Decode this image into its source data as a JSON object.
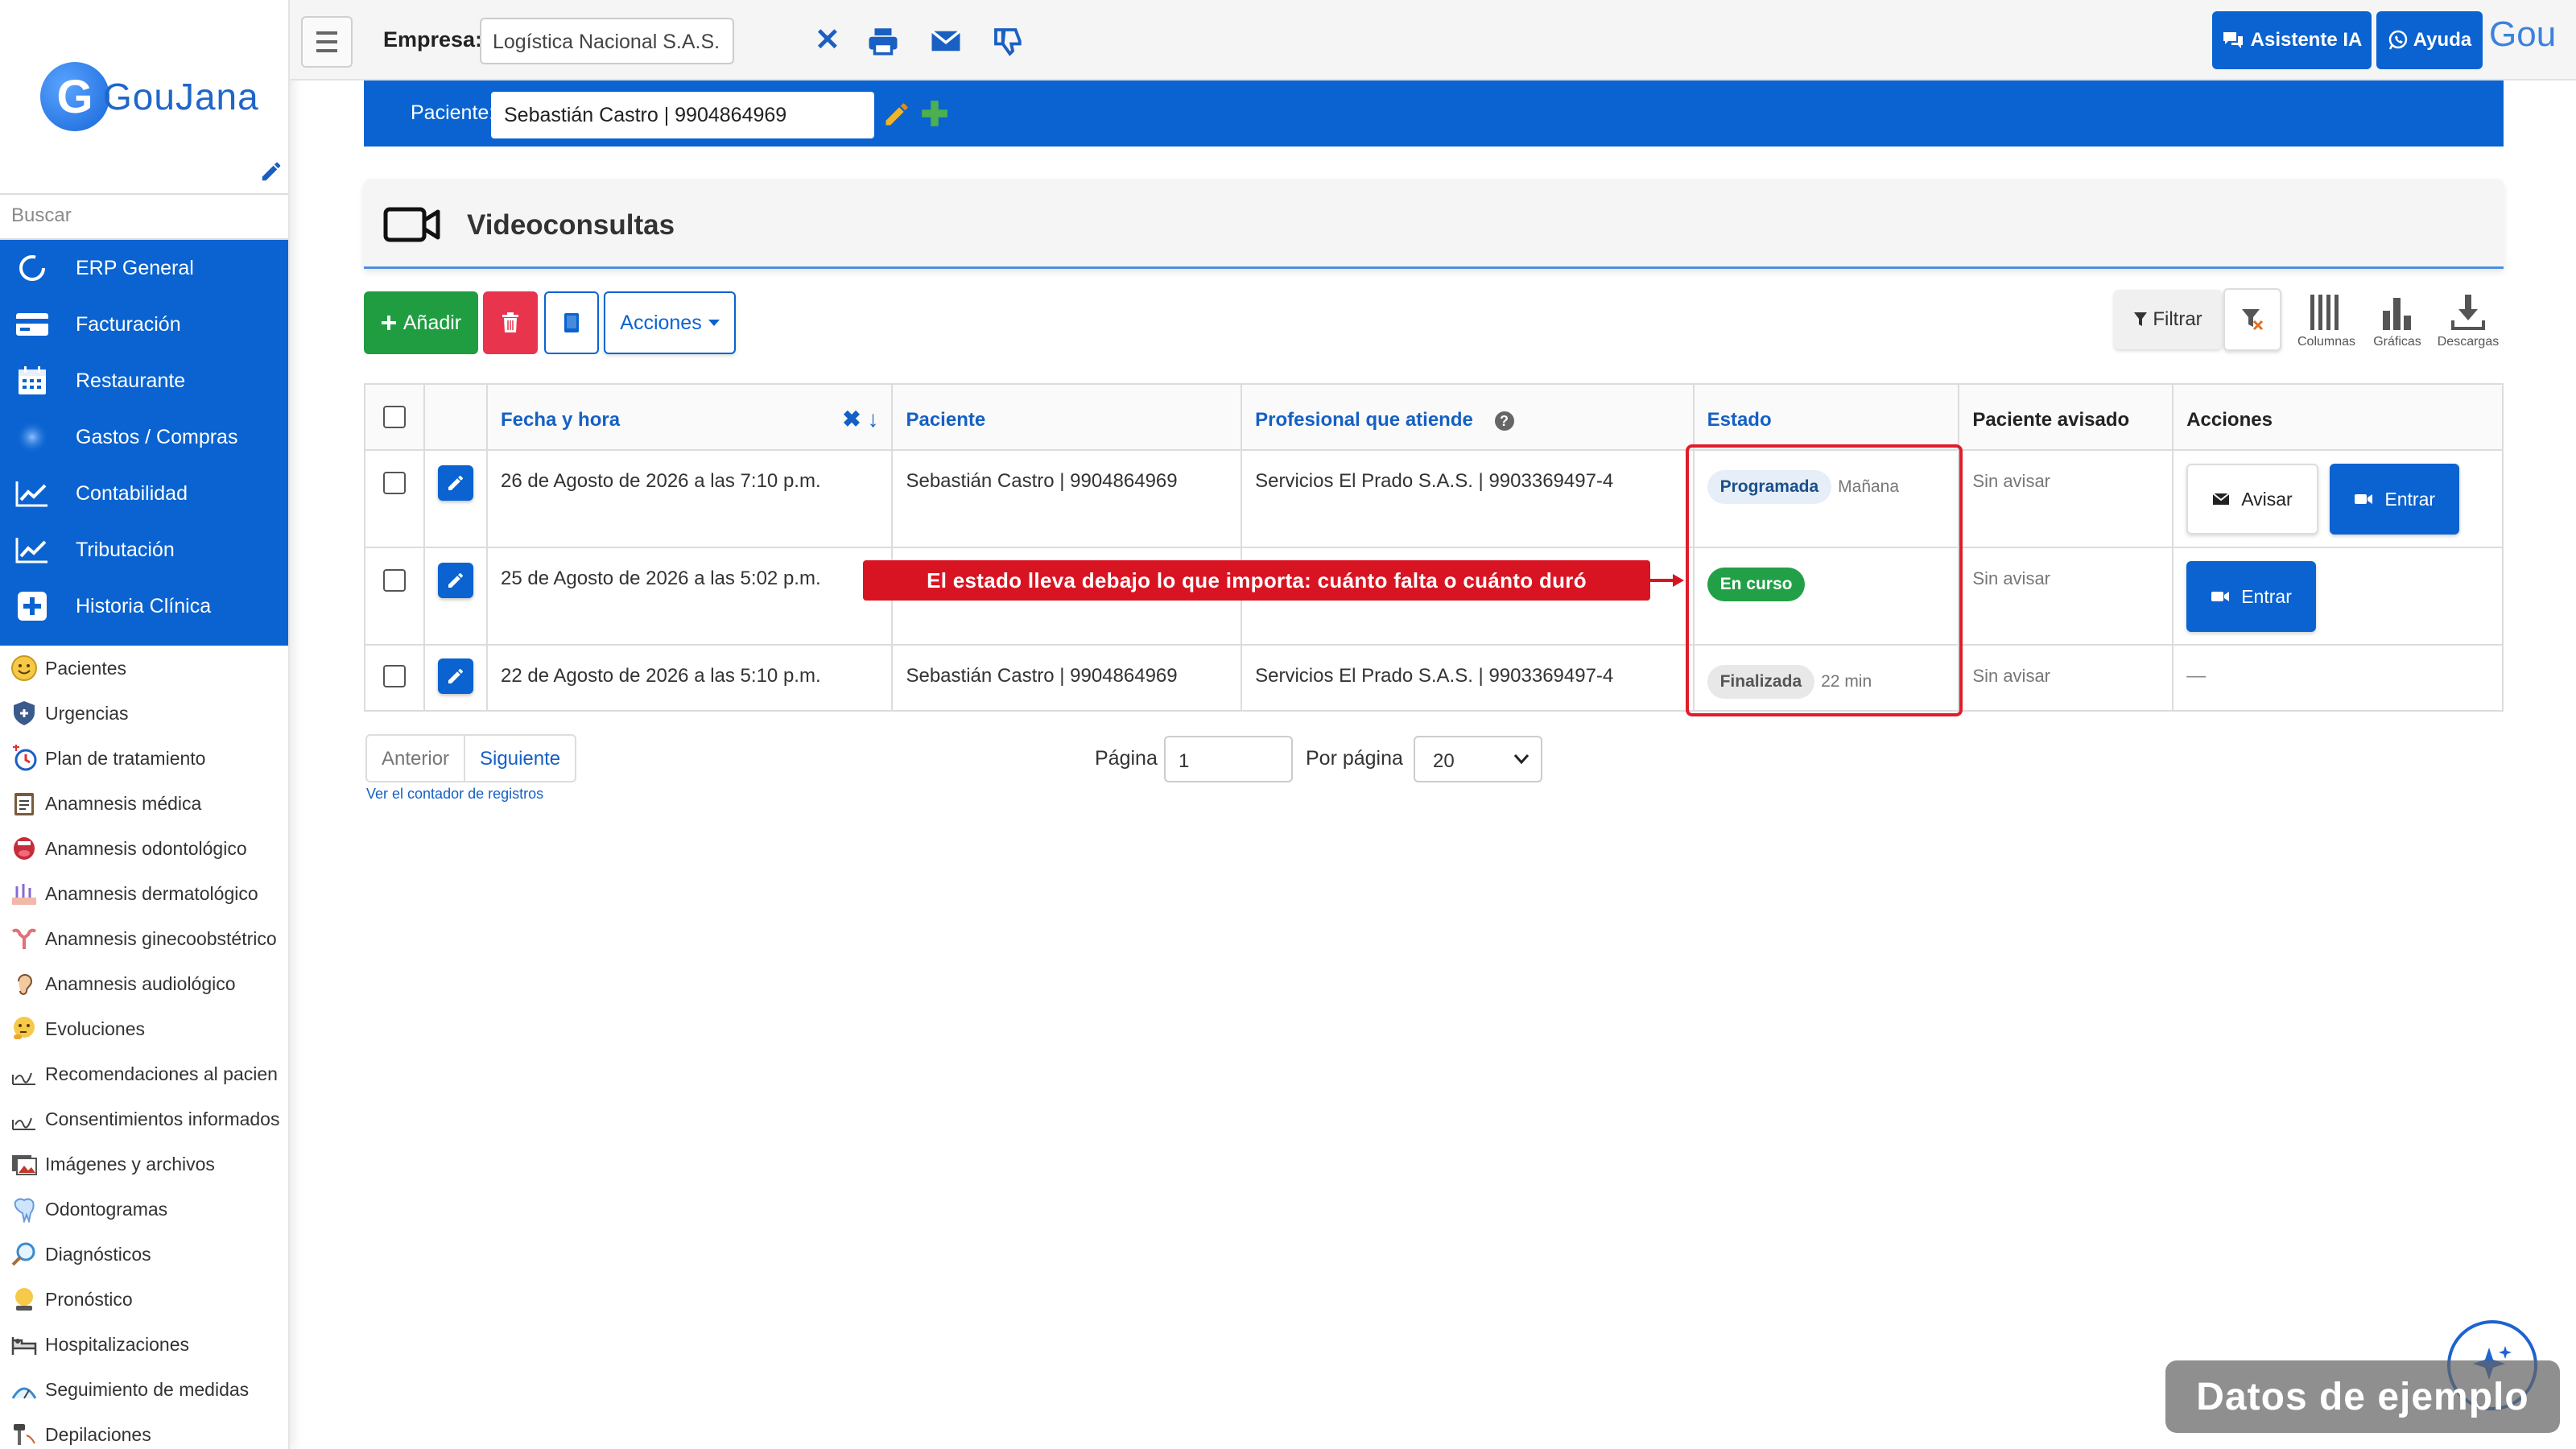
{
  "sidebar": {
    "logo_text": "GouJana",
    "logo_letter": "G",
    "search_placeholder": "Buscar",
    "main_menu": [
      {
        "label": "ERP General",
        "icon": "circle-arrow-icon"
      },
      {
        "label": "Facturación",
        "icon": "card-icon"
      },
      {
        "label": "Restaurante",
        "icon": "calendar-icon"
      },
      {
        "label": "Gastos / Compras",
        "icon": "blur-circle-icon"
      },
      {
        "label": "Contabilidad",
        "icon": "chart-line-icon"
      },
      {
        "label": "Tributación",
        "icon": "chart-line-icon"
      },
      {
        "label": "Historia Clínica",
        "icon": "plus-square-icon"
      }
    ],
    "sub_menu": [
      {
        "label": "Pacientes",
        "icon": "smile-face-icon"
      },
      {
        "label": "Urgencias",
        "icon": "shield-icon"
      },
      {
        "label": "Plan de tratamiento",
        "icon": "compass-icon"
      },
      {
        "label": "Anamnesis médica",
        "icon": "clipboard-icon"
      },
      {
        "label": "Anamnesis odontológico",
        "icon": "mouth-icon"
      },
      {
        "label": "Anamnesis dermatológico",
        "icon": "skin-icon"
      },
      {
        "label": "Anamnesis ginecoobstétrico",
        "icon": "uterus-icon"
      },
      {
        "label": "Anamnesis audiológico",
        "icon": "ear-icon"
      },
      {
        "label": "Evoluciones",
        "icon": "thinking-face-icon"
      },
      {
        "label": "Recomendaciones al pacien",
        "icon": "signature-icon"
      },
      {
        "label": "Consentimientos informados",
        "icon": "signature-icon"
      },
      {
        "label": "Imágenes y archivos",
        "icon": "images-icon"
      },
      {
        "label": "Odontogramas",
        "icon": "tooth-icon"
      },
      {
        "label": "Diagnósticos",
        "icon": "magnifier-icon"
      },
      {
        "label": "Pronóstico",
        "icon": "crystal-ball-icon"
      },
      {
        "label": "Hospitalizaciones",
        "icon": "bed-icon"
      },
      {
        "label": "Seguimiento de medidas",
        "icon": "scale-icon"
      },
      {
        "label": "Depilaciones",
        "icon": "razor-icon"
      }
    ]
  },
  "topbar": {
    "empresa_label": "Empresa:",
    "empresa_value": "Logística Nacional S.A.S.",
    "ia_label": "Asistente IA",
    "ayuda_label": "Ayuda",
    "gou_text": "Gou"
  },
  "patient": {
    "label": "Paciente:",
    "value": "Sebastián Castro | 9904864969"
  },
  "page": {
    "title": "Videoconsultas"
  },
  "toolbar": {
    "add_label": "Añadir",
    "acciones_label": "Acciones",
    "filtrar_label": "Filtrar",
    "columnas_label": "Columnas",
    "graficas_label": "Gráficas",
    "descargas_label": "Descargas"
  },
  "table": {
    "headers": {
      "fecha": "Fecha y hora",
      "paciente": "Paciente",
      "profesional": "Profesional que atiende",
      "estado": "Estado",
      "avisado": "Paciente avisado",
      "acciones": "Acciones"
    },
    "rows": [
      {
        "fecha": "26 de Agosto de 2026 a las 7:10 p.m.",
        "paciente": "Sebastián Castro | 9904864969",
        "profesional": "Servicios El Prado S.A.S. | 9903369497-4",
        "estado": "Programada",
        "estado_hint": "Mañana",
        "avisado": "Sin avisar",
        "avisar_label": "Avisar",
        "entrar_label": "Entrar"
      },
      {
        "fecha": "25 de Agosto de 2026 a las 5:02 p.m.",
        "paciente": "",
        "profesional": "",
        "estado": "En curso",
        "estado_hint": "",
        "avisado": "Sin avisar",
        "entrar_label": "Entrar"
      },
      {
        "fecha": "22 de Agosto de 2026 a las 5:10 p.m.",
        "paciente": "Sebastián Castro | 9904864969",
        "profesional": "Servicios El Prado S.A.S. | 9903369497-4",
        "estado": "Finalizada",
        "estado_hint": "22 min",
        "avisado": "Sin avisar",
        "acciones_text": "—"
      }
    ]
  },
  "callout": {
    "text": "El estado lleva debajo lo que importa: cuánto falta o cuánto duró"
  },
  "pagination": {
    "prev_label": "Anterior",
    "next_label": "Siguiente",
    "counter_link": "Ver el contador de registros",
    "pagina_label": "Página",
    "pagina_value": "1",
    "por_pagina_label": "Por página",
    "por_pagina_value": "20"
  },
  "watermark": {
    "text": "Datos de ejemplo"
  },
  "colors": {
    "brand_blue": "#0a63d0",
    "success_green": "#1f9d40",
    "danger_red": "#e8344d",
    "callout_red": "#d91422"
  }
}
